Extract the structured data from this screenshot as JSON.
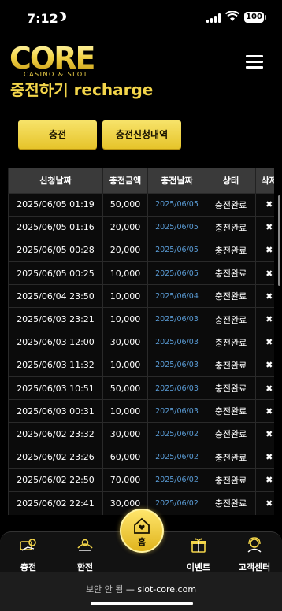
{
  "status_bar": {
    "time": "7:12",
    "battery": "100"
  },
  "header": {
    "logo_main": "CORE",
    "logo_sub": "CASINO & SLOT"
  },
  "section": {
    "title": "충전하기 recharge"
  },
  "buttons": {
    "deposit": "충전",
    "history": "충전신청내역"
  },
  "table": {
    "headers": [
      "신청날짜",
      "충전금액",
      "충전날짜",
      "상태",
      "삭제"
    ],
    "rows": [
      {
        "request": "2025/06/05 01:19",
        "amount": "50,000",
        "date": "2025/06/05",
        "status": "충전완료",
        "delete": "✖"
      },
      {
        "request": "2025/06/05 01:16",
        "amount": "20,000",
        "date": "2025/06/05",
        "status": "충전완료",
        "delete": "✖"
      },
      {
        "request": "2025/06/05 00:28",
        "amount": "20,000",
        "date": "2025/06/05",
        "status": "충전완료",
        "delete": "✖"
      },
      {
        "request": "2025/06/05 00:25",
        "amount": "10,000",
        "date": "2025/06/05",
        "status": "충전완료",
        "delete": "✖"
      },
      {
        "request": "2025/06/04 23:50",
        "amount": "10,000",
        "date": "2025/06/04",
        "status": "충전완료",
        "delete": "✖"
      },
      {
        "request": "2025/06/03 23:21",
        "amount": "10,000",
        "date": "2025/06/03",
        "status": "충전완료",
        "delete": "✖"
      },
      {
        "request": "2025/06/03 12:00",
        "amount": "30,000",
        "date": "2025/06/03",
        "status": "충전완료",
        "delete": "✖"
      },
      {
        "request": "2025/06/03 11:32",
        "amount": "10,000",
        "date": "2025/06/03",
        "status": "충전완료",
        "delete": "✖"
      },
      {
        "request": "2025/06/03 10:51",
        "amount": "50,000",
        "date": "2025/06/03",
        "status": "충전완료",
        "delete": "✖"
      },
      {
        "request": "2025/06/03 00:31",
        "amount": "10,000",
        "date": "2025/06/03",
        "status": "충전완료",
        "delete": "✖"
      },
      {
        "request": "2025/06/02 23:32",
        "amount": "30,000",
        "date": "2025/06/02",
        "status": "충전완료",
        "delete": "✖"
      },
      {
        "request": "2025/06/02 23:26",
        "amount": "60,000",
        "date": "2025/06/02",
        "status": "충전완료",
        "delete": "✖"
      },
      {
        "request": "2025/06/02 22:50",
        "amount": "70,000",
        "date": "2025/06/02",
        "status": "충전완료",
        "delete": "✖"
      },
      {
        "request": "2025/06/02 22:41",
        "amount": "30,000",
        "date": "2025/06/02",
        "status": "충전완료",
        "delete": "✖"
      }
    ]
  },
  "bottom_nav": {
    "deposit": "충전",
    "withdraw": "환전",
    "home": "홈",
    "event": "이벤트",
    "support": "고객센터"
  },
  "browser": {
    "security": "보안 안 됨",
    "separator": " — ",
    "domain": "slot-core.com"
  },
  "colors": {
    "accent": "#f3d54a",
    "link_date": "#5a9cd6",
    "header_bg": "#3a3a3a"
  }
}
